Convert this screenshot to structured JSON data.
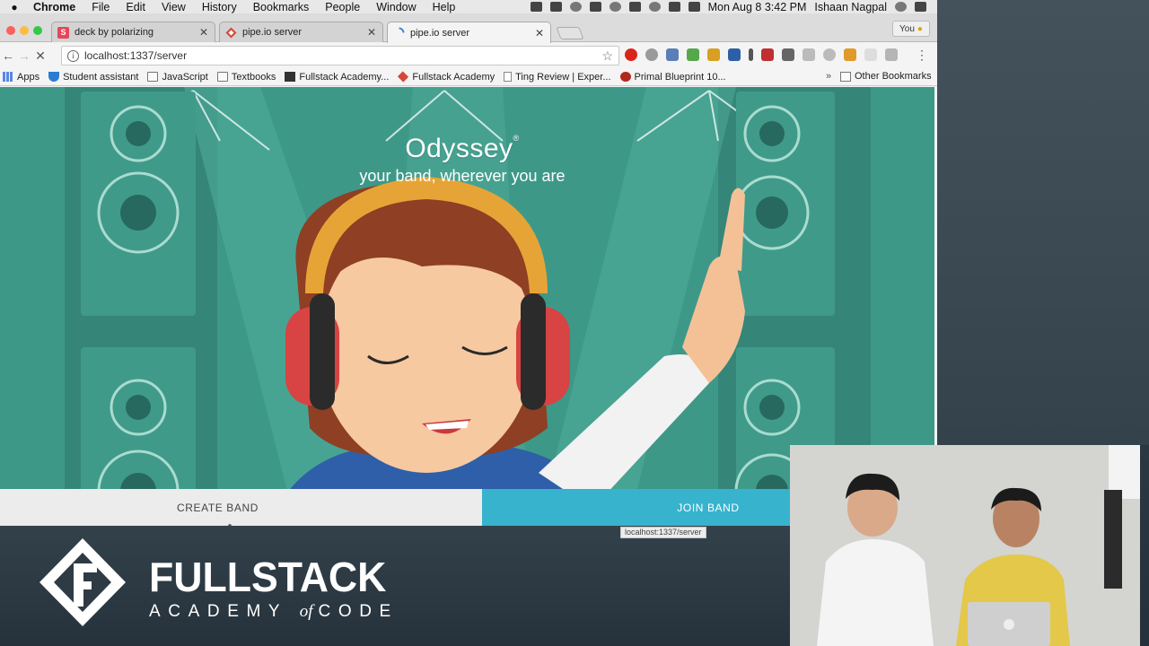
{
  "menubar": {
    "app": "Chrome",
    "items": [
      "File",
      "Edit",
      "View",
      "History",
      "Bookmarks",
      "People",
      "Window",
      "Help"
    ],
    "clock": "Mon Aug 8  3:42 PM",
    "user": "Ishaan Nagpal"
  },
  "tabs": [
    {
      "title": "deck by polarizing",
      "favicon": "slides-icon",
      "favicon_color": "#e5465b",
      "favicon_letter": "S"
    },
    {
      "title": "pipe.io server",
      "favicon": "diamond-icon",
      "favicon_color": "#d6483a"
    },
    {
      "title": "pipe.io server",
      "favicon": "loading-spinner-icon",
      "favicon_color": "#3b7ad6",
      "active": true
    }
  ],
  "profile": {
    "label": "You"
  },
  "address": {
    "url": "localhost:1337/server"
  },
  "bookmarks": {
    "items": [
      {
        "label": "Apps",
        "icon": "apps-grid-icon"
      },
      {
        "label": "Student assistant",
        "icon": "shield-icon"
      },
      {
        "label": "JavaScript",
        "icon": "folder-icon"
      },
      {
        "label": "Textbooks",
        "icon": "folder-icon"
      },
      {
        "label": "Fullstack Academy...",
        "icon": "fullstack-icon"
      },
      {
        "label": "Fullstack Academy",
        "icon": "diamond-icon"
      },
      {
        "label": "Ting Review | Exper...",
        "icon": "page-icon"
      },
      {
        "label": "Primal Blueprint 10...",
        "icon": "primal-icon"
      }
    ],
    "more": "»",
    "other": "Other Bookmarks"
  },
  "page": {
    "title": "Odyssey",
    "title_mark": "®",
    "tagline": "your band, wherever you are",
    "create_button": "CREATE BAND",
    "join_button": "JOIN BAND",
    "status_url": "localhost:1337/server"
  },
  "brand": {
    "name": "FULLSTACK",
    "sub_left": "ACADEMY",
    "sub_of": "of",
    "sub_right": "CODE"
  },
  "colors": {
    "page_bg": "#3e9888",
    "join_button": "#37b3cd",
    "create_button": "#ececec"
  }
}
